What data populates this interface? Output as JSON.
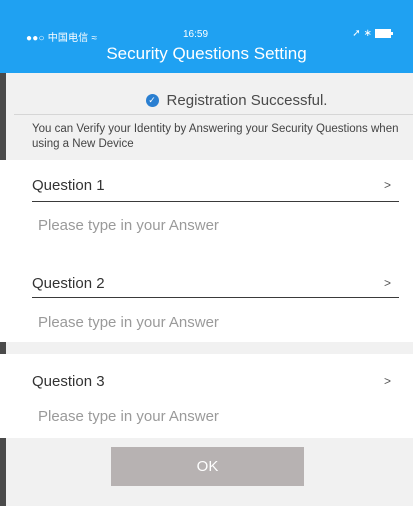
{
  "status_bar": {
    "carrier": "●●○ 中国电信 ",
    "wifi_icon": "wifi-icon",
    "time": "16:59",
    "location_icon": "location-arrow-icon",
    "bluetooth_icon": "bluetooth-icon",
    "battery_icon": "battery-icon"
  },
  "header": {
    "title": "Security Questions Setting",
    "color": "#1fa1f2"
  },
  "success": {
    "icon": "check-circle-icon",
    "text": "Registration Successful."
  },
  "hint": "You can Verify your Identity by Answering your Security Questions when using a New Device",
  "questions": [
    {
      "label": "Question 1",
      "chevron": ">",
      "answer_placeholder": "Please type in your Answer",
      "answer_value": ""
    },
    {
      "label": "Question 2",
      "chevron": ">",
      "answer_placeholder": "Please type in your Answer",
      "answer_value": ""
    },
    {
      "label": "Question 3",
      "chevron": ">",
      "answer_placeholder": "Please type in your Answer",
      "answer_value": ""
    }
  ],
  "ok_button": {
    "label": "OK",
    "color": "#b7b2b2"
  }
}
